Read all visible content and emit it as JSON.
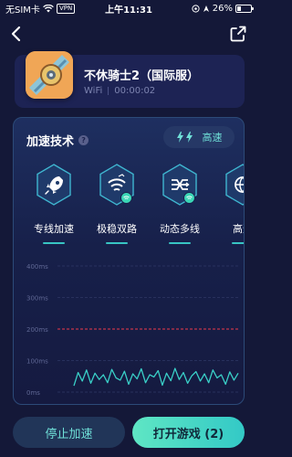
{
  "status_bar": {
    "carrier": "无SIM卡",
    "vpn": "VPN",
    "time": "上午11:31",
    "battery": "26%",
    "battery_level": 0.26
  },
  "nav": {
    "back_icon": "chevron-left-icon",
    "share_icon": "share-icon"
  },
  "game": {
    "title": "不休骑士2（国际服）",
    "network": "WiFi",
    "elapsed": "00:00:02"
  },
  "accel": {
    "title": "加速技术",
    "help_icon": "question-icon",
    "speed_label": "高速",
    "items": [
      {
        "label": "专线加速",
        "icon": "rocket-icon"
      },
      {
        "label": "极稳双路",
        "icon": "wifi-dual-icon"
      },
      {
        "label": "动态多线",
        "icon": "multi-line-icon"
      },
      {
        "label": "高速",
        "icon": "globe-icon"
      }
    ]
  },
  "latency_chart": {
    "ticks": [
      "400ms",
      "300ms",
      "200ms",
      "100ms",
      "0ms"
    ]
  },
  "chart_data": {
    "type": "line",
    "y_unit": "ms",
    "ylim": [
      0,
      400
    ],
    "threshold": 200,
    "series": [
      {
        "values": [
          20,
          62,
          35,
          70,
          28,
          60,
          40,
          55,
          30,
          72,
          45,
          38,
          66,
          25,
          58,
          42,
          74,
          30,
          55,
          48,
          68,
          22,
          60,
          36,
          75,
          40,
          62,
          28,
          52,
          65,
          35,
          58,
          30,
          70,
          45,
          55,
          25,
          64,
          38,
          60
        ]
      }
    ]
  },
  "buttons": {
    "stop": "停止加速",
    "open": "打开游戏 (2)"
  },
  "colors": {
    "background": "#141838",
    "accent": "#3ad0c8",
    "threshold": "#c4344a"
  }
}
